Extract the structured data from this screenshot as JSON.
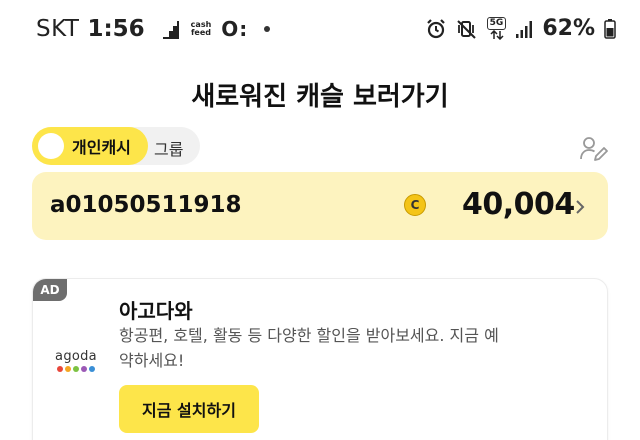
{
  "status_bar": {
    "carrier": "SKT",
    "time": "1:56",
    "cashfeed_line1": "cash",
    "cashfeed_line2": "feed",
    "ot_label": "O:",
    "network": "5G",
    "battery": "62%"
  },
  "page": {
    "title": "새로워진 캐슬 보러가기"
  },
  "toggle": {
    "active_label": "개인캐시",
    "inactive_label": "그룹"
  },
  "account": {
    "id": "a01050511918",
    "coin_symbol": "C",
    "amount": "40,004"
  },
  "ad": {
    "badge": "AD",
    "brand": "agoda",
    "brand_dot_colors": [
      "#e8473b",
      "#f5a623",
      "#7cc242",
      "#9b59b6",
      "#3a8fd6"
    ],
    "title": "아고다와",
    "description": "항공편, 호텔, 활동 등 다양한 할인을 받아보세요. 지금 예약하세요!",
    "button_label": "지금 설치하기"
  },
  "colors": {
    "accent_yellow": "#fde54a",
    "card_yellow": "#fdf3bf",
    "coin_gold": "#f4c417"
  }
}
